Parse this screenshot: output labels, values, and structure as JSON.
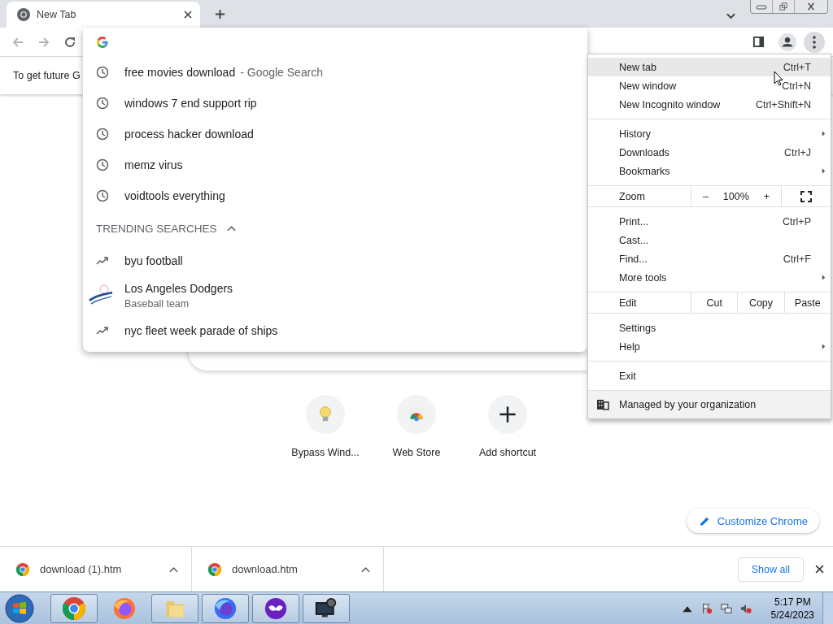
{
  "tabs": [
    {
      "title": "New Tab",
      "selected": true
    }
  ],
  "info_bar": {
    "text": "To get future G"
  },
  "omnibox_dropdown": {
    "history": [
      {
        "text": "free movies download",
        "suffix": "- Google Search"
      },
      {
        "text": "windows 7 end support rip"
      },
      {
        "text": "process hacker download"
      },
      {
        "text": "memz virus"
      },
      {
        "text": "voidtools everything"
      }
    ],
    "trending_header": "TRENDING SEARCHES",
    "trending_expanded": true,
    "trending": [
      {
        "kind": "trend",
        "text": "byu football"
      },
      {
        "kind": "entity",
        "text": "Los Angeles Dodgers",
        "subtitle": "Baseball team"
      },
      {
        "kind": "trend",
        "text": "nyc fleet week parade of ships"
      }
    ]
  },
  "shortcuts": [
    {
      "kind": "bulb",
      "label": "Bypass Wind..."
    },
    {
      "kind": "webstore",
      "label": "Web Store"
    },
    {
      "kind": "add",
      "label": "Add shortcut"
    }
  ],
  "customize_button": "Customize Chrome",
  "menu": {
    "sections": [
      {
        "kind": "items",
        "items": [
          {
            "label": "New tab",
            "shortcut": "Ctrl+T",
            "submenu": false,
            "selected": true
          },
          {
            "label": "New window",
            "shortcut": "Ctrl+N",
            "submenu": false,
            "selected": false
          },
          {
            "label": "New Incognito window",
            "shortcut": "Ctrl+Shift+N",
            "submenu": false,
            "selected": false
          }
        ]
      },
      {
        "kind": "items",
        "items": [
          {
            "label": "History",
            "submenu": true,
            "selected": false
          },
          {
            "label": "Downloads",
            "shortcut": "Ctrl+J",
            "submenu": false,
            "selected": false
          },
          {
            "label": "Bookmarks",
            "submenu": true,
            "selected": false
          }
        ]
      },
      {
        "kind": "zoom",
        "label": "Zoom",
        "minus": "–",
        "value": "100%",
        "plus": "+"
      },
      {
        "kind": "items",
        "items": [
          {
            "label": "Print...",
            "shortcut": "Ctrl+P",
            "submenu": false,
            "selected": false
          },
          {
            "label": "Cast...",
            "submenu": false,
            "selected": false
          },
          {
            "label": "Find...",
            "shortcut": "Ctrl+F",
            "submenu": false,
            "selected": false
          },
          {
            "label": "More tools",
            "submenu": true,
            "selected": false
          }
        ]
      },
      {
        "kind": "edit",
        "label": "Edit",
        "buttons": [
          "Cut",
          "Copy",
          "Paste"
        ]
      },
      {
        "kind": "items",
        "items": [
          {
            "label": "Settings",
            "submenu": false,
            "selected": false
          },
          {
            "label": "Help",
            "submenu": true,
            "selected": false
          }
        ]
      },
      {
        "kind": "items",
        "items": [
          {
            "label": "Exit",
            "submenu": false,
            "selected": false
          }
        ]
      },
      {
        "kind": "managed",
        "label": "Managed by your organization"
      }
    ]
  },
  "downloads": {
    "items": [
      {
        "name": "download (1).htm"
      },
      {
        "name": "download.htm"
      }
    ],
    "show_all": "Show all"
  },
  "taskbar": {
    "apps": [
      {
        "kind": "chrome",
        "running": true
      },
      {
        "kind": "firefox",
        "running": false
      },
      {
        "kind": "folder",
        "running": true
      },
      {
        "kind": "firefox-dev",
        "running": true
      },
      {
        "kind": "mask",
        "running": true
      },
      {
        "kind": "monitor",
        "running": true
      }
    ],
    "time": "5:17 PM",
    "date": "5/24/2023"
  }
}
